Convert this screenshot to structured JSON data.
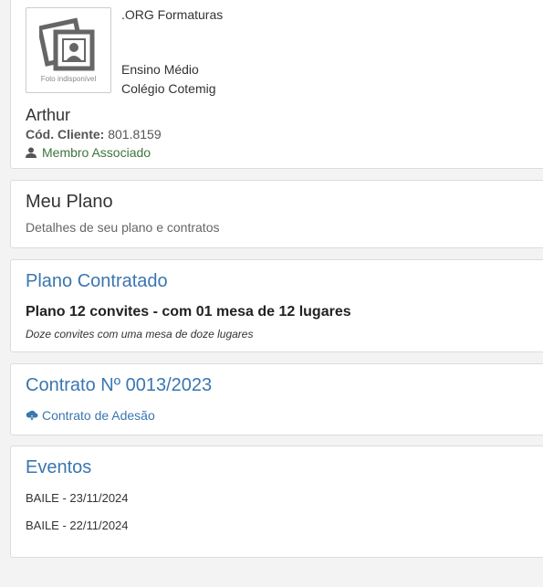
{
  "profile": {
    "photo_caption": "Foto indisponível",
    "org_name": ".ORG Formaturas",
    "school_level": "Ensino Médio",
    "school_name": "Colégio Cotemig",
    "user_name": "Arthur",
    "client_code_label": "Cód. Cliente:",
    "client_code_value": "801.8159",
    "member_status": "Membro Associado",
    "member_icon": "user-icon"
  },
  "my_plan": {
    "title": "Meu Plano",
    "subtitle": "Detalhes de seu plano e contratos"
  },
  "contracted_plan": {
    "title": "Plano Contratado",
    "plan_name": "Plano 12 convites - com 01 mesa de 12 lugares",
    "plan_description": "Doze convites com uma mesa de doze lugares"
  },
  "contract": {
    "title": "Contrato Nº 0013/2023",
    "link_label": "Contrato de Adesão",
    "link_icon": "cloud-download-icon"
  },
  "events": {
    "title": "Eventos",
    "items": [
      "BAILE - 23/11/2024",
      "BAILE - 22/11/2024"
    ]
  },
  "colors": {
    "link_blue": "#3a76b0",
    "member_green": "#3c763d",
    "background": "#f3f3f3"
  }
}
